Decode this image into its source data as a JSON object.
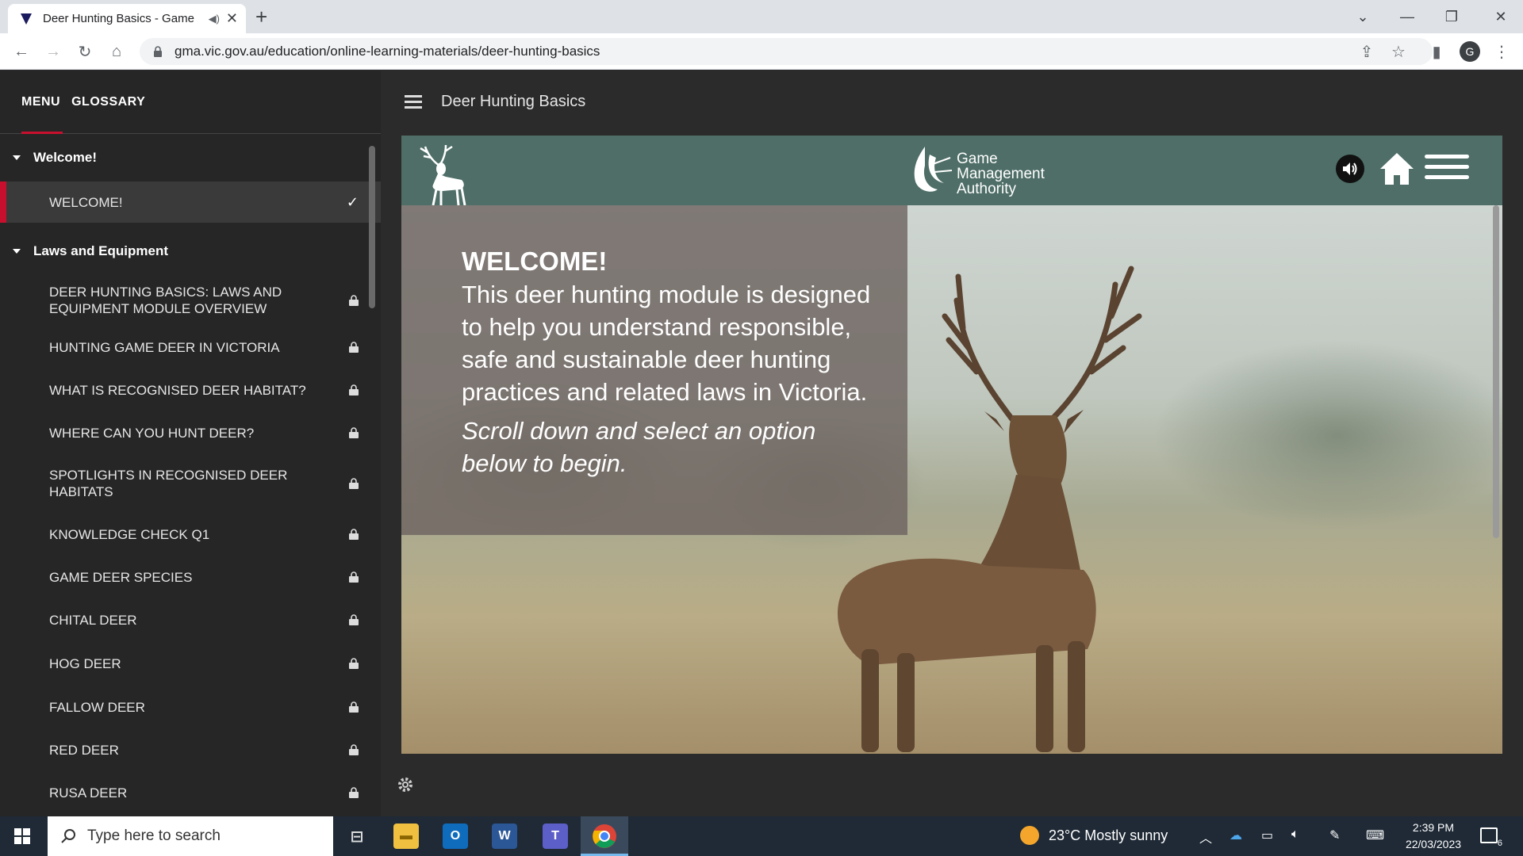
{
  "browser": {
    "tab_title": "Deer Hunting Basics - Game",
    "url": "gma.vic.gov.au/education/online-learning-materials/deer-hunting-basics",
    "profile_initial": "G"
  },
  "sidebar": {
    "tabs": [
      "MENU",
      "GLOSSARY"
    ],
    "sections": [
      {
        "title": "Welcome!",
        "items": [
          {
            "label": "WELCOME!",
            "state": "complete"
          }
        ]
      },
      {
        "title": "Laws and Equipment",
        "items": [
          {
            "label": "DEER HUNTING BASICS: LAWS AND EQUIPMENT MODULE OVERVIEW",
            "state": "locked"
          },
          {
            "label": "HUNTING GAME DEER IN VICTORIA",
            "state": "locked"
          },
          {
            "label": "WHAT IS RECOGNISED DEER HABITAT?",
            "state": "locked"
          },
          {
            "label": "WHERE CAN YOU HUNT DEER?",
            "state": "locked"
          },
          {
            "label": "SPOTLIGHTS IN RECOGNISED DEER HABITATS",
            "state": "locked"
          },
          {
            "label": "KNOWLEDGE CHECK Q1",
            "state": "locked"
          },
          {
            "label": "GAME DEER SPECIES",
            "state": "locked"
          },
          {
            "label": "CHITAL DEER",
            "state": "locked"
          },
          {
            "label": "HOG DEER",
            "state": "locked"
          },
          {
            "label": "FALLOW DEER",
            "state": "locked"
          },
          {
            "label": "RED DEER",
            "state": "locked"
          },
          {
            "label": "RUSA DEER",
            "state": "locked"
          }
        ]
      }
    ]
  },
  "content": {
    "course_title": "Deer Hunting Basics",
    "logo_text": [
      "Game",
      "Management",
      "Authority"
    ],
    "welcome_heading": "WELCOME!",
    "welcome_body": "This deer hunting module is designed to help you understand responsible, safe and sustainable deer hunting practices and related laws in Victoria.",
    "welcome_cta": "Scroll down and select an option below to begin."
  },
  "taskbar": {
    "search_placeholder": "Type here to search",
    "weather": "23°C  Mostly sunny",
    "time": "2:39 PM",
    "date": "22/03/2023",
    "notification_count": "6"
  },
  "colors": {
    "banner": "#4e6e67",
    "accent": "#c8102e",
    "sidebar": "#262626"
  }
}
